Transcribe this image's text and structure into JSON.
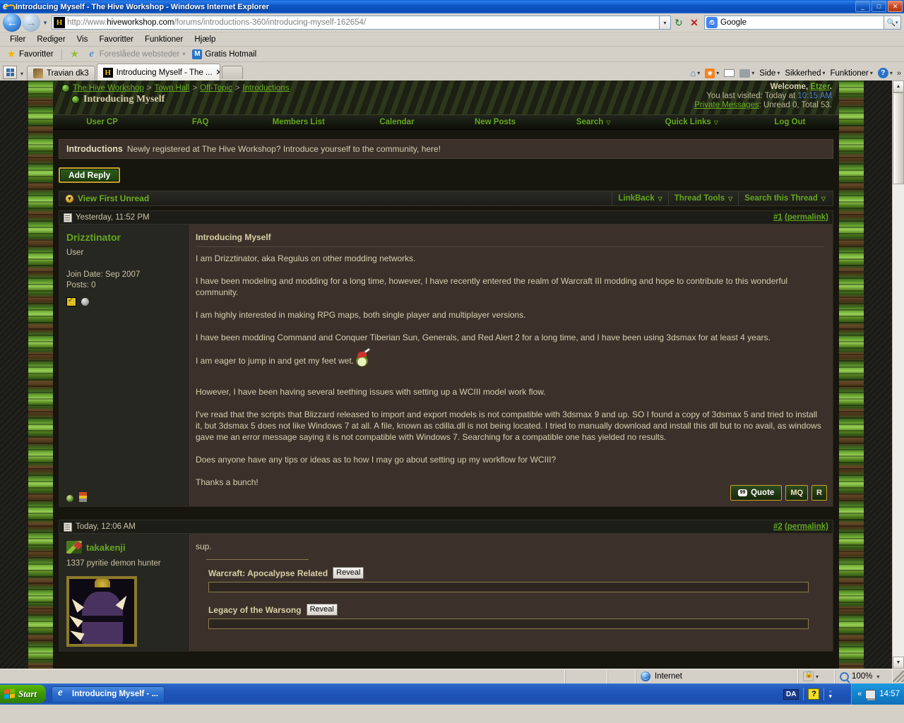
{
  "window": {
    "title": "Introducing Myself - The Hive Workshop - Windows Internet Explorer",
    "minimize": "_",
    "maximize": "□",
    "close": "✕"
  },
  "browser": {
    "back_icon": "←",
    "forward_icon": "→",
    "history_caret": "▾",
    "url_prefix": "http://www.",
    "url_domain": "hiveworkshop.com",
    "url_path": "/forums/introductions-360/introducing-myself-162654/",
    "favicon_letter": "H",
    "address_dropdown": "▾",
    "refresh_icon": "↻",
    "stop_icon": "✕",
    "search_placeholder": "Google",
    "search_go": "🔍",
    "search_caret": "▾"
  },
  "menu": {
    "items": [
      "Filer",
      "Rediger",
      "Vis",
      "Favoritter",
      "Funktioner",
      "Hjælp"
    ]
  },
  "favbar": {
    "favorites_label": "Favoritter",
    "suggested_label": "Foreslåede websteder",
    "suggested_caret": "▾",
    "hotmail_label": "Gratis Hotmail",
    "hotmail_icon_letter": "M"
  },
  "tabs": {
    "quicktabs_tooltip": "Quick Tabs",
    "list_caret": "▾",
    "items": [
      {
        "label": "Travian dk3",
        "active": false,
        "close": ""
      },
      {
        "label": "Introducing Myself - The ...",
        "active": true,
        "close": "✕"
      }
    ],
    "commands": [
      {
        "name": "home",
        "label": "",
        "caret": "▾"
      },
      {
        "name": "feeds",
        "label": "",
        "caret": "▾"
      },
      {
        "name": "mail",
        "label": "",
        "caret": ""
      },
      {
        "name": "print",
        "label": "",
        "caret": "▾"
      },
      {
        "name": "page",
        "label": "Side",
        "caret": "▾"
      },
      {
        "name": "safety",
        "label": "Sikkerhed",
        "caret": "▾"
      },
      {
        "name": "tools",
        "label": "Funktioner",
        "caret": "▾"
      },
      {
        "name": "help",
        "label": "",
        "caret": "▾"
      }
    ],
    "overflow": "»"
  },
  "site": {
    "breadcrumb": [
      {
        "label": "The Hive Workshop"
      },
      {
        "label": "Town Hall"
      },
      {
        "label": "Off-Topic"
      },
      {
        "label": "Introductions"
      }
    ],
    "breadcrumb_sep": ">",
    "thread_title": "Introducing Myself",
    "welcome": {
      "greeting_prefix": "Welcome, ",
      "username": "Etzer",
      "greeting_suffix": ".",
      "last_visit_label": "You last visited: Today at ",
      "last_visit_time": "10:15 AM",
      "pm_label": "Private Messages",
      "pm_counts": ": Unread 0, Total 53."
    },
    "nav": [
      {
        "label": "User CP",
        "caret": ""
      },
      {
        "label": "FAQ",
        "caret": ""
      },
      {
        "label": "Members List",
        "caret": ""
      },
      {
        "label": "Calendar",
        "caret": ""
      },
      {
        "label": "New Posts",
        "caret": ""
      },
      {
        "label": "Search",
        "caret": "▽"
      },
      {
        "label": "Quick Links",
        "caret": "▽"
      },
      {
        "label": "Log Out",
        "caret": ""
      }
    ],
    "forum_name": "Introductions",
    "forum_desc": "Newly registered at The Hive Workshop? Introduce yourself to the community, here!",
    "add_reply_label": "Add Reply",
    "view_first_unread": "View First Unread",
    "thread_tools": [
      {
        "label": "LinkBack",
        "caret": "▽"
      },
      {
        "label": "Thread Tools",
        "caret": "▽"
      },
      {
        "label": "Search this Thread",
        "caret": "▽"
      }
    ]
  },
  "posts": [
    {
      "timestamp": "Yesterday, 11:52 PM",
      "number": "#1",
      "permalink": "(permalink)",
      "author": "Drizztinator",
      "user_title": "User",
      "join_date": "Join Date: Sep 2007",
      "post_count": "Posts: 0",
      "subject": "Introducing Myself",
      "paragraphs": [
        "I am Drizztinator, aka Regulus on other modding networks.",
        "I have been modeling and modding for a long time, however, I have recently entered the realm of Warcraft III modding and hope to contribute to this wonderful community.",
        "I am highly interested in making RPG maps, both single player and multiplayer versions.",
        "I have been modding Command and Conquer Tiberian Sun, Generals, and Red Alert 2 for a long time, and I have been using 3dsmax for at least 4 years.",
        "I am eager to jump in and get my feet wet.",
        "However, I have been having several teething issues with setting up a WCIII model work flow.",
        "I've read that the scripts that Blizzard released to import and export models is not compatible with 3dsmax 9 and up. SO I found a copy of 3dsmax 5 and tried to install it, but 3dsmax 5 does not like Windows 7 at all. A file, known as cdilla.dll is not being located. I tried to manually download and install this dll but to no avail, as windows gave me an error message saying it is not compatible with Windows 7. Searching for a compatible one has yielded no results.",
        "Does anyone have any tips or ideas as to how I may go about setting up my workflow for WCIII?",
        "Thanks a bunch!"
      ],
      "quote_label": "Quote",
      "multiquote_label": "MQ",
      "reply_label": "R"
    },
    {
      "timestamp": "Today, 12:06 AM",
      "number": "#2",
      "permalink": "(permalink)",
      "author": "takakenji",
      "user_title": "1337 pyritie demon hunter",
      "body_text": "sup.",
      "spoilers": [
        {
          "title": "Warcraft: Apocalypse Related",
          "button": "Reveal"
        },
        {
          "title": "Legacy of the Warsong",
          "button": "Reveal"
        }
      ]
    }
  ],
  "statusbar": {
    "zone_label": "Internet",
    "protected_caret": "▾",
    "zoom_level": "100%",
    "zoom_caret": "▾"
  },
  "taskbar": {
    "start_label": "Start",
    "items": [
      {
        "label": "Introducing Myself - ..."
      }
    ],
    "tray": {
      "language": "DA",
      "help_glyph": "?",
      "expand_glyph": "«",
      "clock": "14:57"
    }
  },
  "colors": {
    "accent_green": "#63a81f",
    "gold": "#c8a22a",
    "post_bg": "#3b312a",
    "text": "#d7cdb0",
    "titlebar_blue": "#1a5fc8"
  }
}
